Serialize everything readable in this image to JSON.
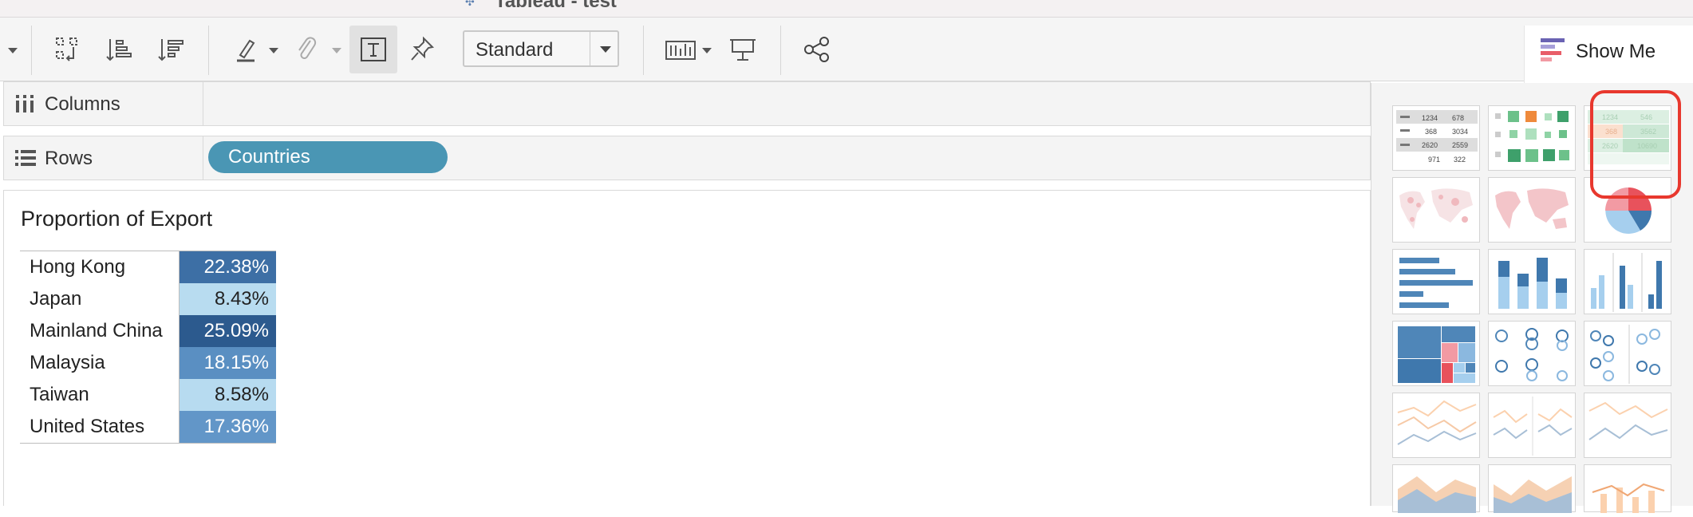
{
  "window": {
    "title": "Tableau - test"
  },
  "toolbar": {
    "mark_label_dropdown": "Standard",
    "buttons": [
      "swap-rows-columns",
      "sort-ascending",
      "sort-descending",
      "highlight",
      "group-members",
      "show-mark-labels",
      "fix-axes",
      "fit",
      "presentation-mode",
      "share"
    ]
  },
  "show_me": {
    "label": "Show Me"
  },
  "shelves": {
    "columns": {
      "label": "Columns"
    },
    "rows": {
      "label": "Rows",
      "pill": "Countries"
    }
  },
  "view": {
    "title": "Proportion of Export",
    "rows": [
      {
        "name": "Hong Kong",
        "value": "22.38%",
        "color": "#3d6fa5"
      },
      {
        "name": "Japan",
        "value": "8.43%",
        "color": "#b8dcf0"
      },
      {
        "name": "Mainland China",
        "value": "25.09%",
        "color": "#2c5a8e"
      },
      {
        "name": "Malaysia",
        "value": "18.15%",
        "color": "#5a8fc2"
      },
      {
        "name": "Taiwan",
        "value": "8.58%",
        "color": "#b7dbf0"
      },
      {
        "name": "United States",
        "value": "17.36%",
        "color": "#6296c8"
      }
    ]
  },
  "show_me_panel": {
    "tiles": [
      "text-table",
      "symbol-map-squares",
      "highlight-table",
      "symbol-map",
      "filled-map",
      "pie-chart",
      "horizontal-bars",
      "stacked-bars",
      "side-by-side-bars",
      "treemap",
      "circle-views",
      "side-by-side-circles",
      "lines-continuous",
      "lines-discrete",
      "dual-lines",
      "area-continuous",
      "area-discrete",
      "dual-combination"
    ],
    "highlight_table_sample": [
      "1234",
      "546",
      "368",
      "3562",
      "2620",
      "10690"
    ],
    "text_table_sample": [
      "1234",
      "678",
      "368",
      "3034",
      "2620",
      "2559",
      "971",
      "322"
    ]
  },
  "colors": {
    "accent": "#4a96b4",
    "highlight_box": "#e8382e"
  }
}
